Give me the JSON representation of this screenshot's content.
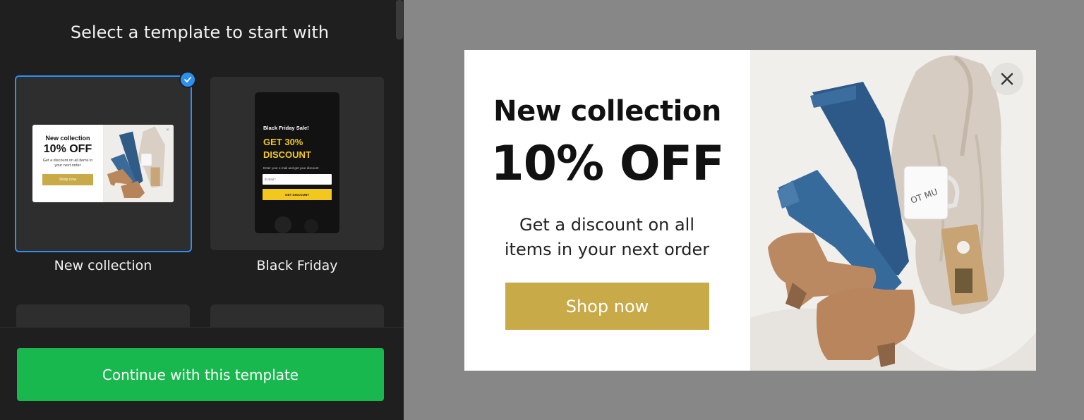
{
  "sidebar": {
    "title": "Select a template to start with",
    "templates": [
      {
        "label": "New collection",
        "selected": true
      },
      {
        "label": "Black Friday",
        "selected": false
      }
    ],
    "continue_label": "Continue with this template"
  },
  "mini_new_collection": {
    "heading": "New collection",
    "offer": "10% OFF",
    "desc": "Get a discount on all items in your next order",
    "button": "Shop now"
  },
  "mini_black_friday": {
    "title": "Black Friday Sale!",
    "offer_line1": "GET 30%",
    "offer_line2": "DISCOUNT",
    "desc": "Enter your e-mail and get your discount",
    "input_placeholder": "E-mail *",
    "button": "GET DISCOUNT"
  },
  "popup": {
    "heading": "New collection",
    "offer": "10% OFF",
    "description": "Get a discount on all items in your next order",
    "button_label": "Shop now"
  },
  "colors": {
    "accent_blue": "#2d8fef",
    "continue_green": "#18b84f",
    "shop_gold": "#c9aa48",
    "bf_yellow": "#f2c81f"
  }
}
